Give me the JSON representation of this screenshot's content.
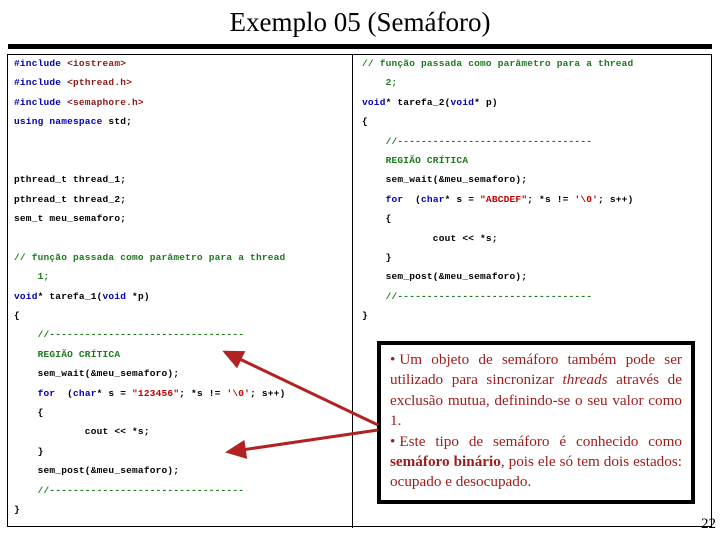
{
  "slide": {
    "title": "Exemplo 05 (Semáforo)",
    "page_number": "22",
    "accent_color": "#9e1b1b",
    "arrow_color": "#b22222"
  },
  "code_left": {
    "lines": [
      [
        {
          "t": "#include ",
          "c": "pp"
        },
        {
          "t": "<iostream>",
          "c": "hdr"
        }
      ],
      [
        {
          "t": "#include ",
          "c": "pp"
        },
        {
          "t": "<pthread.h>",
          "c": "hdr"
        }
      ],
      [
        {
          "t": "#include ",
          "c": "pp"
        },
        {
          "t": "<semaphore.h>",
          "c": "hdr"
        }
      ],
      [
        {
          "t": "using namespace ",
          "c": "kw"
        },
        {
          "t": "std;",
          "c": "plain"
        }
      ],
      [],
      [],
      [
        {
          "t": "pthread_t thread_1;",
          "c": "plain"
        }
      ],
      [
        {
          "t": "pthread_t thread_2;",
          "c": "plain"
        }
      ],
      [
        {
          "t": "sem_t meu_semaforo;",
          "c": "plain"
        }
      ],
      [],
      [
        {
          "t": "// função passada como parâmetro para a thread",
          "c": "cmt"
        }
      ],
      [
        {
          "t": "    1;",
          "c": "cmt"
        }
      ],
      [
        {
          "t": "void",
          "c": "kw"
        },
        {
          "t": "* tarefa_1(",
          "c": "plain"
        },
        {
          "t": "void",
          "c": "kw"
        },
        {
          "t": " *p)",
          "c": "plain"
        }
      ],
      [
        {
          "t": "{",
          "c": "plain"
        }
      ],
      [
        {
          "t": "    //---------------------------------",
          "c": "cmt"
        }
      ],
      [
        {
          "t": "    REGIÃO CRÍTICA",
          "c": "cmt"
        }
      ],
      [
        {
          "t": "    sem_wait(&meu_semaforo);",
          "c": "plain"
        }
      ],
      [
        {
          "t": "    ",
          "c": "plain"
        },
        {
          "t": "for",
          "c": "kw"
        },
        {
          "t": "  (",
          "c": "plain"
        },
        {
          "t": "char",
          "c": "kw"
        },
        {
          "t": "* s = ",
          "c": "plain"
        },
        {
          "t": "\"123456\"",
          "c": "str"
        },
        {
          "t": "; *s != ",
          "c": "plain"
        },
        {
          "t": "'\\0'",
          "c": "str"
        },
        {
          "t": "; s++)",
          "c": "plain"
        }
      ],
      [
        {
          "t": "    {",
          "c": "plain"
        }
      ],
      [
        {
          "t": "            cout << *s;",
          "c": "plain"
        }
      ],
      [
        {
          "t": "    }",
          "c": "plain"
        }
      ],
      [
        {
          "t": "    sem_post(&meu_semaforo);",
          "c": "plain"
        }
      ],
      [
        {
          "t": "    //---------------------------------",
          "c": "cmt"
        }
      ],
      [
        {
          "t": "}",
          "c": "plain"
        }
      ]
    ]
  },
  "code_right": {
    "lines": [
      [
        {
          "t": "// função passada como parâmetro para a thread",
          "c": "cmt"
        }
      ],
      [
        {
          "t": "    2;",
          "c": "cmt"
        }
      ],
      [
        {
          "t": "void",
          "c": "kw"
        },
        {
          "t": "* tarefa_2(",
          "c": "plain"
        },
        {
          "t": "void",
          "c": "kw"
        },
        {
          "t": "* p)",
          "c": "plain"
        }
      ],
      [
        {
          "t": "{",
          "c": "plain"
        }
      ],
      [
        {
          "t": "    //---------------------------------",
          "c": "cmt"
        }
      ],
      [
        {
          "t": "    REGIÃO CRÍTICA",
          "c": "cmt"
        }
      ],
      [
        {
          "t": "    sem_wait(&meu_semaforo);",
          "c": "plain"
        }
      ],
      [
        {
          "t": "    ",
          "c": "plain"
        },
        {
          "t": "for",
          "c": "kw"
        },
        {
          "t": "  (",
          "c": "plain"
        },
        {
          "t": "char",
          "c": "kw"
        },
        {
          "t": "* s = ",
          "c": "plain"
        },
        {
          "t": "\"ABCDEF\"",
          "c": "str"
        },
        {
          "t": "; *s != ",
          "c": "plain"
        },
        {
          "t": "'\\0'",
          "c": "str"
        },
        {
          "t": "; s++)",
          "c": "plain"
        }
      ],
      [
        {
          "t": "    {",
          "c": "plain"
        }
      ],
      [
        {
          "t": "            cout << *s;",
          "c": "plain"
        }
      ],
      [
        {
          "t": "    }",
          "c": "plain"
        }
      ],
      [
        {
          "t": "    sem_post(&meu_semaforo);",
          "c": "plain"
        }
      ],
      [
        {
          "t": "    //---------------------------------",
          "c": "cmt"
        }
      ],
      [
        {
          "t": "}",
          "c": "plain"
        }
      ]
    ]
  },
  "callout": {
    "bullet_glyph": "•",
    "item1_part1": "Um objeto de semáforo também pode ser utilizado para sincronizar ",
    "item1_italic": "threads",
    "item1_part2": " através de exclusão mutua, definindo-se o seu valor como 1.",
    "item2_part1": "Este tipo de semáforo é conhecido como ",
    "item2_bold": "semáforo binário",
    "item2_part2": ", pois ele só tem dois estados: ocupado e desocupado."
  }
}
